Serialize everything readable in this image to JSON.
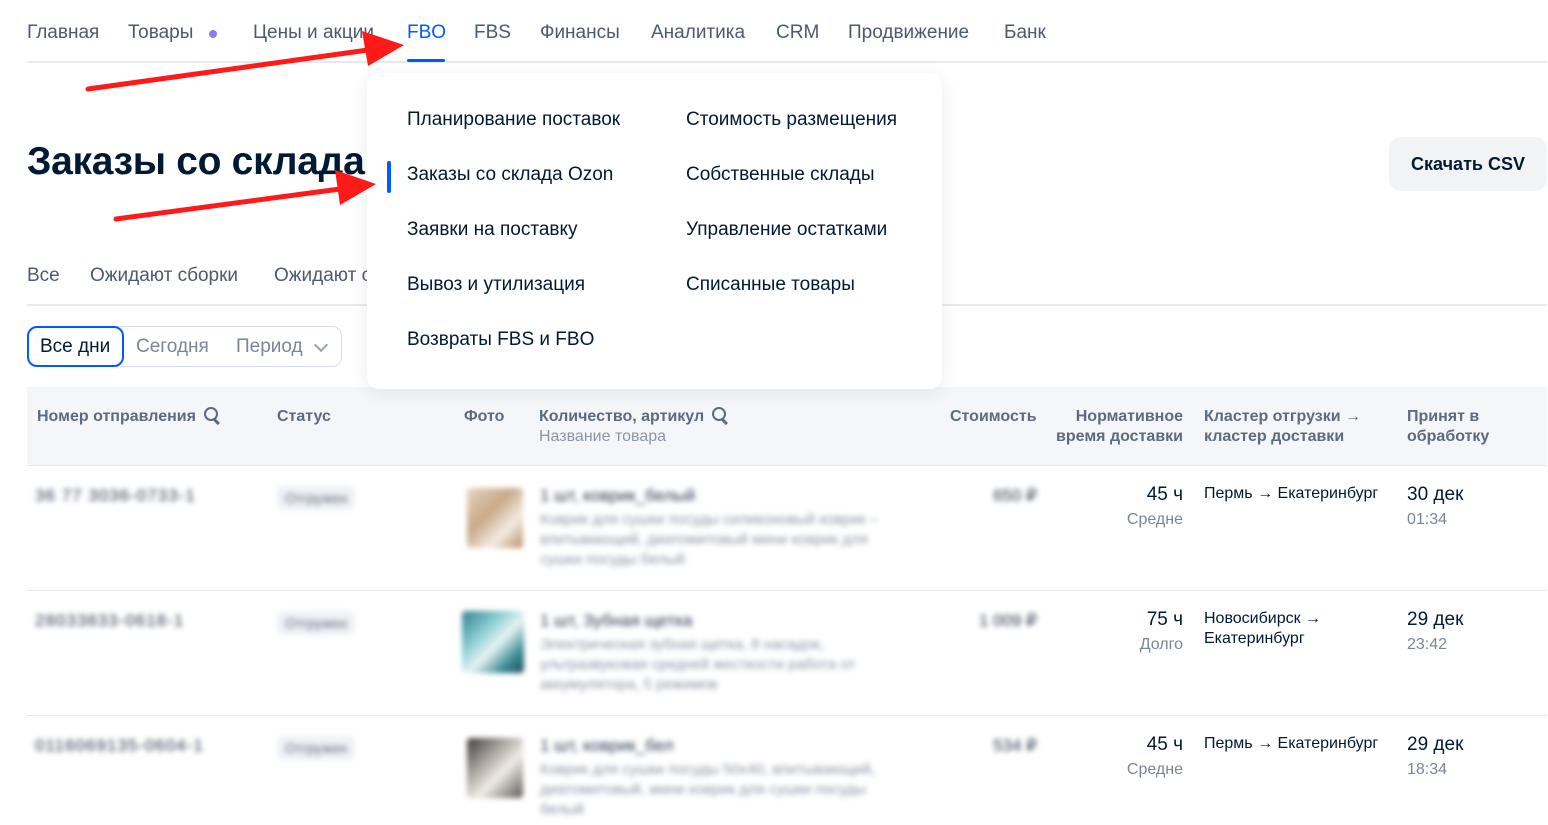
{
  "nav": {
    "items": [
      {
        "label": "Главная"
      },
      {
        "label": "Товары"
      },
      {
        "label": "Цены и акции"
      },
      {
        "label": "FBO"
      },
      {
        "label": "FBS"
      },
      {
        "label": "Финансы"
      },
      {
        "label": "Аналитика"
      },
      {
        "label": "CRM"
      },
      {
        "label": "Продвижение"
      },
      {
        "label": "Банк"
      }
    ],
    "active": "FBO"
  },
  "page": {
    "title": "Заказы со склада",
    "download_label": "Скачать CSV"
  },
  "subtabs": [
    "Все",
    "Ожидают сборки",
    "Ожидают с"
  ],
  "date_filter": {
    "active": "Все дни",
    "today": "Сегодня",
    "period": "Период"
  },
  "dropdown": {
    "left": [
      "Планирование поставок",
      "Заказы со склада Ozon",
      "Заявки на поставку",
      "Вывоз и утилизация",
      "Возвраты FBS и FBO"
    ],
    "right": [
      "Стоимость размещения",
      "Собственные склады",
      "Управление остатками",
      "Списанные товары"
    ],
    "selected": "Заказы со склада Ozon"
  },
  "table": {
    "headers": {
      "order": "Номер отправления",
      "status": "Статус",
      "photo": "Фото",
      "qty": "Количество, артикул",
      "qty_sub": "Название товара",
      "price": "Стоимость",
      "norm_1": "Нормативное",
      "norm_2": "время доставки",
      "cluster_1": "Кластер отгрузки →",
      "cluster_2": "кластер доставки",
      "accepted_1": "Принят в",
      "accepted_2": "обработку"
    },
    "rows": [
      {
        "order_no": "36 77 3036-0733-1",
        "status": "Отгружен",
        "title": "1 шт, коврик_белый",
        "desc": "Коврик для сушки посуды силиконовый коврик – впитывающий, диатомитовый мини коврик для сушки посуды белый",
        "price": "650 ₽",
        "hours": "45 ч",
        "speed": "Средне",
        "route": "Пермь → Екатеринбург",
        "date": "30 дек",
        "time": "01:34",
        "photo_color": "#d8c2a8"
      },
      {
        "order_no": "28033833-0618-1",
        "status": "Отгружен",
        "title": "1 шт, Зубная щетка",
        "desc": "Электрическая зубная щетка, 8 насадок, ультразвуковая средней жесткости работа от аккумулятора, 5 режимов",
        "price": "1 009 ₽",
        "hours": "75 ч",
        "speed": "Долго",
        "route": "Новосибирск → Екатеринбург",
        "date": "29 дек",
        "time": "23:42",
        "photo_color": "#4e9aa6"
      },
      {
        "order_no": "0116069135-0604-1",
        "status": "Отгружен",
        "title": "1 шт, коврик_бел",
        "desc": "Коврик для сушки посуды 50х40, впитывающий, диатомитовый, мини коврик для сушки посуды белый",
        "price": "534 ₽",
        "hours": "45 ч",
        "speed": "Средне",
        "route": "Пермь → Екатеринбург",
        "date": "29 дек",
        "time": "18:34",
        "photo_color": "#6f6a64"
      }
    ]
  },
  "colors": {
    "accent": "#005bff",
    "arrow": "#ff1a1a"
  }
}
